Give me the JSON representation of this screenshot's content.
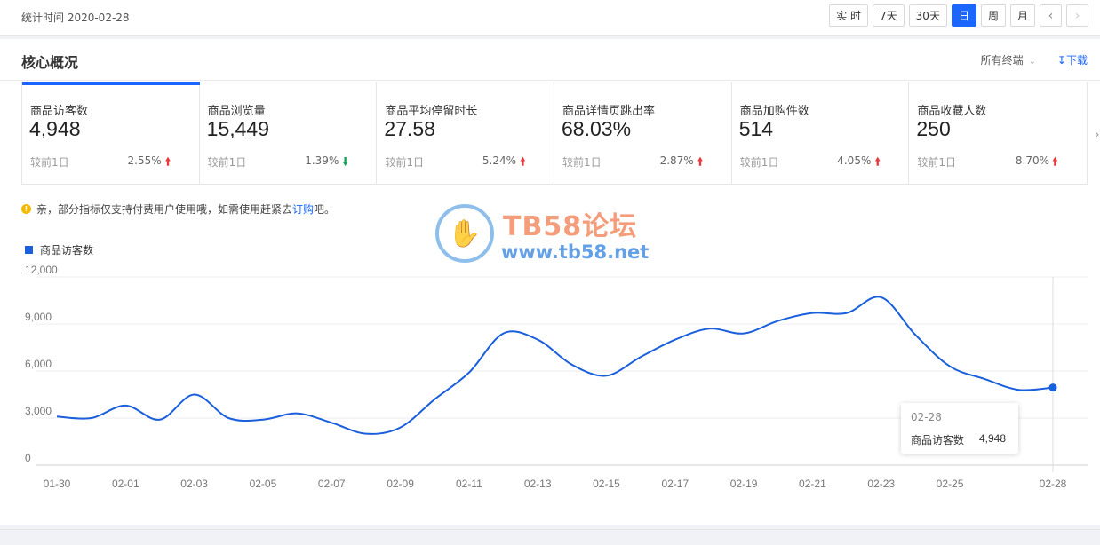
{
  "header": {
    "stat_time": "统计时间 2020-02-28",
    "periods": [
      {
        "label": "实 时",
        "active": false
      },
      {
        "label": "7天",
        "active": false
      },
      {
        "label": "30天",
        "active": false
      },
      {
        "label": "日",
        "active": true
      },
      {
        "label": "周",
        "active": false
      },
      {
        "label": "月",
        "active": false
      }
    ],
    "prev_icon": "‹",
    "next_icon": "›"
  },
  "panel": {
    "title": "核心概况",
    "terminal_select": "所有终端",
    "download_label": "下载"
  },
  "cards": [
    {
      "label": "商品访客数",
      "value": "4,948",
      "compare": "较前1日",
      "pct": "2.55%",
      "trend": "up"
    },
    {
      "label": "商品浏览量",
      "value": "15,449",
      "compare": "较前1日",
      "pct": "1.39%",
      "trend": "down"
    },
    {
      "label": "商品平均停留时长",
      "value": "27.58",
      "compare": "较前1日",
      "pct": "5.24%",
      "trend": "up"
    },
    {
      "label": "商品详情页跳出率",
      "value": "68.03%",
      "compare": "较前1日",
      "pct": "2.87%",
      "trend": "up"
    },
    {
      "label": "商品加购件数",
      "value": "514",
      "compare": "较前1日",
      "pct": "4.05%",
      "trend": "up"
    },
    {
      "label": "商品收藏人数",
      "value": "250",
      "compare": "较前1日",
      "pct": "8.70%",
      "trend": "up"
    }
  ],
  "notice": {
    "text_before": "亲，部分指标仅支持付费用户使用哦，如需使用赶紧去",
    "link": "订购",
    "text_after": "吧。"
  },
  "watermark": {
    "title": "TB58论坛",
    "url": "www.tb58.net"
  },
  "tooltip": {
    "date": "02-28",
    "series_name": "商品访客数",
    "value": "4,948"
  },
  "colors": {
    "accent": "#1a66ff",
    "line": "#1a5fdc",
    "up": "#e8383d",
    "down": "#18a058"
  },
  "chart_data": {
    "type": "line",
    "title": "",
    "xlabel": "",
    "ylabel": "",
    "ylim": [
      0,
      12000
    ],
    "y_ticks": [
      "0",
      "3,000",
      "6,000",
      "9,000",
      "12,000"
    ],
    "y_tick_values": [
      0,
      3000,
      6000,
      9000,
      12000
    ],
    "x": [
      "01-30",
      "01-31",
      "02-01",
      "02-02",
      "02-03",
      "02-04",
      "02-05",
      "02-06",
      "02-07",
      "02-08",
      "02-09",
      "02-10",
      "02-11",
      "02-12",
      "02-13",
      "02-14",
      "02-15",
      "02-16",
      "02-17",
      "02-18",
      "02-19",
      "02-20",
      "02-21",
      "02-22",
      "02-23",
      "02-24",
      "02-25",
      "02-26",
      "02-27",
      "02-28"
    ],
    "x_tick_labels": [
      "01-30",
      "02-01",
      "02-03",
      "02-05",
      "02-07",
      "02-09",
      "02-11",
      "02-13",
      "02-15",
      "02-17",
      "02-19",
      "02-21",
      "02-23",
      "02-25",
      "02-28"
    ],
    "series": [
      {
        "name": "商品访客数",
        "values": [
          3100,
          3000,
          3800,
          2900,
          4500,
          3000,
          2900,
          3300,
          2700,
          2000,
          2400,
          4200,
          5900,
          8400,
          8000,
          6400,
          5700,
          6900,
          8000,
          8700,
          8400,
          9200,
          9700,
          9700,
          10700,
          8300,
          6300,
          5500,
          4800,
          4948
        ]
      }
    ],
    "grid": true,
    "legend": "top-left"
  }
}
